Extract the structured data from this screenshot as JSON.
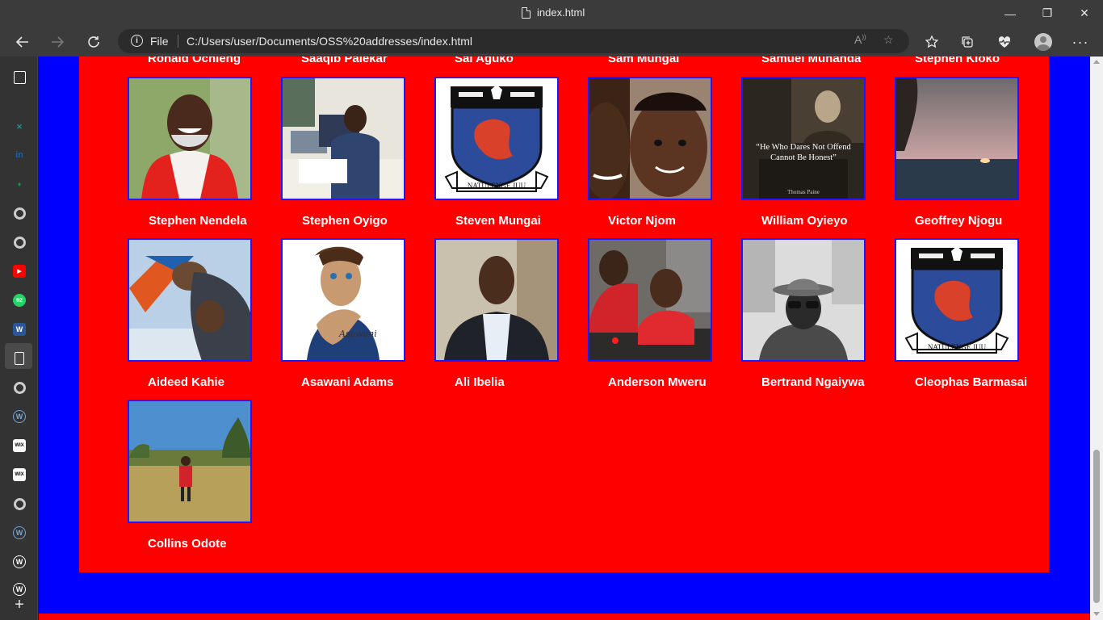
{
  "window": {
    "title": "index.html",
    "controls": {
      "minimize": "—",
      "maximize": "❐",
      "close": "✕"
    }
  },
  "addressbar": {
    "scheme_label": "File",
    "url": "C:/Users/user/Documents/OSS%20addresses/index.html"
  },
  "toolbar_icons": [
    "read-aloud-icon",
    "add-favorite-icon",
    "favorites-icon",
    "collections-icon",
    "browser-essentials-icon",
    "profile-icon",
    "more-icon"
  ],
  "sidebar": {
    "items": [
      {
        "name": "tab-actions-icon",
        "glyph": "",
        "color": "#ffffff"
      },
      {
        "name": "site-icon-1",
        "glyph": "",
        "color": "#555555"
      },
      {
        "name": "site-icon-x",
        "glyph": "✕",
        "color": "#1a9b8f"
      },
      {
        "name": "linkedin-icon",
        "glyph": "in",
        "color": "#0a66c2"
      },
      {
        "name": "site-icon-green",
        "glyph": "♦",
        "color": "#1a8f3a"
      },
      {
        "name": "google-icon",
        "glyph": "G",
        "color": "#cccccc"
      },
      {
        "name": "google-icon",
        "glyph": "G",
        "color": "#cccccc"
      },
      {
        "name": "youtube-icon",
        "glyph": "▶",
        "color": "#ff0000"
      },
      {
        "name": "whatsapp-icon",
        "glyph": "92",
        "color": "#25d366"
      },
      {
        "name": "word-icon",
        "glyph": "W",
        "color": "#2b579a"
      },
      {
        "name": "file-icon",
        "glyph": "",
        "color": "#ffffff"
      },
      {
        "name": "google-icon",
        "glyph": "G",
        "color": "#cccccc"
      },
      {
        "name": "wordpress-icon",
        "glyph": "W",
        "color": "#7aa7d6"
      },
      {
        "name": "wix-icon",
        "glyph": "WIX",
        "color": "#ffffff"
      },
      {
        "name": "wix-icon",
        "glyph": "WIX",
        "color": "#bbbbbb"
      },
      {
        "name": "google-icon",
        "glyph": "G",
        "color": "#cccccc"
      },
      {
        "name": "wordpress-icon",
        "glyph": "W",
        "color": "#7aa7d6"
      },
      {
        "name": "wordpress-icon",
        "glyph": "W",
        "color": "#ffffff"
      },
      {
        "name": "wordpress-icon",
        "glyph": "W",
        "color": "#ffffff"
      }
    ],
    "add_label": "+"
  },
  "page": {
    "top_row_names": [
      "Ronald Ochieng",
      "Saaqib Palekar",
      "Sai Aguko",
      "Sam Mungai",
      "Samuel Muhanda",
      "Stephen Kioko"
    ],
    "rows": [
      [
        {
          "name": "Stephen Nendela",
          "image": "smiling-man-red-vest-photo"
        },
        {
          "name": "Stephen Oyigo",
          "image": "man-at-office-desk-photo"
        },
        {
          "name": "Steven Mungai",
          "image": "school-crest-logo"
        },
        {
          "name": "Victor Njom",
          "image": "father-and-child-selfie-photo"
        },
        {
          "name": "William Oyieyo",
          "image": "quote-poster"
        },
        {
          "name": "Geoffrey Njogu",
          "image": "sunset-over-water-photo"
        }
      ],
      [
        {
          "name": "Aideed Kahie",
          "image": "skydiving-photo"
        },
        {
          "name": "Asawani Adams",
          "image": "cartoon-avatar"
        },
        {
          "name": "Ali Ibelia",
          "image": "man-in-vest-photo"
        },
        {
          "name": "Anderson Mweru",
          "image": "man-and-child-photo"
        },
        {
          "name": "Bertrand Ngaiywa",
          "image": "man-in-hat-bw-photo"
        },
        {
          "name": "Cleophas Barmasai",
          "image": "school-crest-logo"
        }
      ],
      [
        {
          "name": "Collins Odote",
          "image": "savanna-photo"
        }
      ]
    ],
    "quote": {
      "text": "“He Who Dares Not Offend Cannot Be Honest”",
      "author": "Thomas Paine"
    },
    "crest_motto": "NATULENGE JUU",
    "cartoon_signature": "Asawani"
  },
  "colors": {
    "page_background": "#0000ff",
    "panel": "#ff0000",
    "card_border": "#1a1aff",
    "name_text": "#ffffff"
  }
}
